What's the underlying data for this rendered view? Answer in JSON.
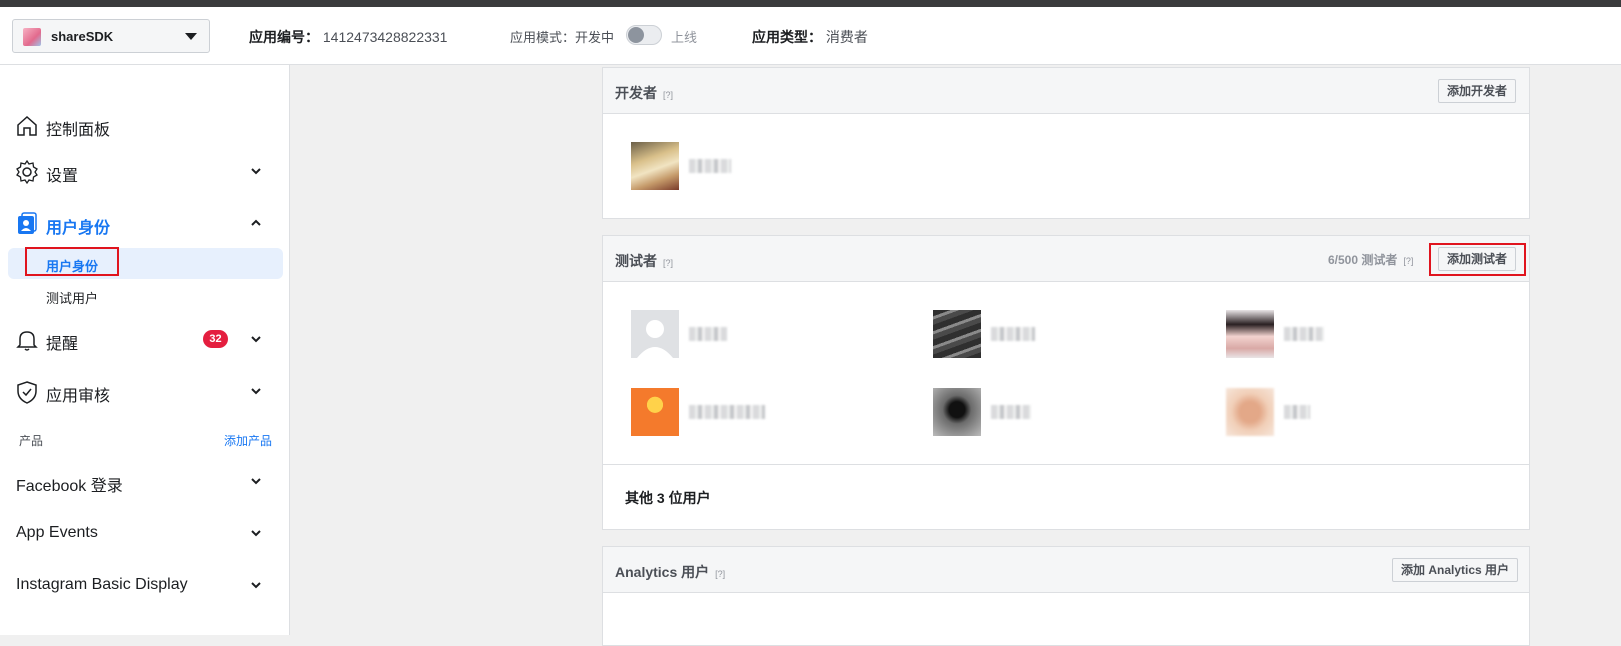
{
  "topbar": {
    "app_name": "shareSDK",
    "app_id_label": "应用编号：",
    "app_id_value": "1412473428822331",
    "mode_label": "应用模式：",
    "mode_dev": "开发中",
    "mode_live": "上线",
    "type_label": "应用类型：",
    "type_value": "消费者"
  },
  "sidebar": {
    "dashboard": "控制面板",
    "settings": "设置",
    "roles": "用户身份",
    "roles_sub_roles": "用户身份",
    "roles_sub_test": "测试用户",
    "alerts": "提醒",
    "alerts_count": "32",
    "review": "应用审核",
    "products_label": "产品",
    "add_product": "添加产品",
    "products": [
      "Facebook 登录",
      "App Events",
      "Instagram Basic Display"
    ]
  },
  "developers": {
    "title": "开发者",
    "help": "[?]",
    "add_button": "添加开发者"
  },
  "testers": {
    "title": "测试者",
    "help": "[?]",
    "count": "6/500 测试者",
    "count_help": "[?]",
    "add_button": "添加测试者",
    "other_users": "其他 3 位用户"
  },
  "analytics": {
    "title": "Analytics 用户",
    "help": "[?]",
    "add_button": "添加 Analytics 用户"
  },
  "colors": {
    "accent": "#1877f2",
    "highlight": "#e0141e",
    "badge": "#e41e3f"
  }
}
